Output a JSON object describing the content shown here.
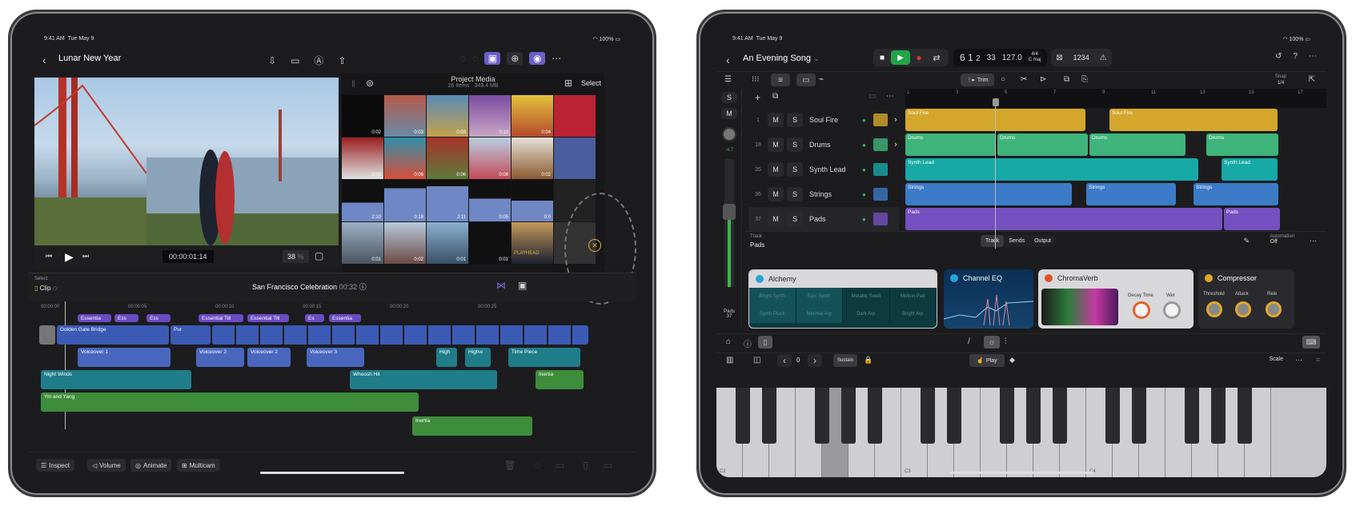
{
  "left_app": {
    "status_time": "9:41 AM",
    "status_date": "Tue May 9",
    "battery": "100%",
    "nav_title": "Lunar New Year",
    "media_browser": {
      "title": "Project Media",
      "subtitle": "26 Items · 349.4 MB",
      "select_label": "Select",
      "durations": [
        "0:02",
        "0:03",
        "0:03",
        "0:10",
        "0:04",
        "",
        "0:02",
        "0:06",
        "0:06",
        "0:08",
        "0:02",
        "",
        "2:10",
        "0:18",
        "2:11",
        "0:05",
        "0:0",
        "",
        "0:01",
        "0:02",
        "0:01",
        "0:01",
        "0:",
        ""
      ],
      "playhead_label": "PLAYHEAD"
    },
    "viewer": {
      "timecode": "00:00:01:14",
      "zoom_percent": "38",
      "zoom_unit": "%"
    },
    "timeline": {
      "select_label": "Select",
      "select_mode": "Clip",
      "project_title": "San Francisco Celebration",
      "project_duration": "00:32",
      "ruler_ticks": [
        "00:00:00",
        "00:00:05",
        "00:00:10",
        "00:00:15",
        "00:00:20",
        "00:00:25"
      ],
      "titles": [
        "Essentia",
        "Ess",
        "Ess",
        "Essential Titl",
        "Essential Titl",
        "Es",
        "Essentia"
      ],
      "primary_clips": [
        "Golden Gate Bridge",
        "Pur"
      ],
      "voiceovers": [
        "Voiceover 1",
        "Voiceover 2",
        "Voiceover 2",
        "Voiceover 3",
        "High",
        "Highw",
        "Time Piece"
      ],
      "sfx": [
        "Night Winds",
        "Whoosh Hit",
        "Inertia"
      ],
      "music": [
        "Yin and Yang",
        "Inertia"
      ]
    },
    "bottom_bar": {
      "inspect": "Inspect",
      "volume": "Volume",
      "animate": "Animate",
      "multicam": "Multicam"
    }
  },
  "right_app": {
    "status_time": "9:41 AM",
    "status_date": "Tue May 9",
    "battery": "100%",
    "song_title": "An Evening Song",
    "lcd": {
      "bar": "6",
      "beat": "1",
      "div": "2",
      "tick": "33",
      "tempo": "127.0",
      "signature": "4/4",
      "key": "C maj"
    },
    "count_in": "1234",
    "trim_label": "Trim",
    "snap_label": "Snap",
    "snap_value": "1/4",
    "ruler": [
      "1",
      "3",
      "5",
      "7",
      "9",
      "11",
      "13",
      "15",
      "17"
    ],
    "tracks": [
      {
        "num": "1",
        "name": "Soul Fire",
        "color": "#d4a72c",
        "regions": [
          "Soul Fire",
          "Soul Fire"
        ]
      },
      {
        "num": "18",
        "name": "Drums",
        "color": "#3fb47a",
        "regions": [
          "Drums",
          "Drums",
          "Drums",
          "Drums"
        ]
      },
      {
        "num": "35",
        "name": "Synth Lead",
        "color": "#17a9a6",
        "regions": [
          "Synth Lead",
          "Synth Lead"
        ]
      },
      {
        "num": "36",
        "name": "Strings",
        "color": "#3c7bc8",
        "regions": [
          "Strings",
          "Strings",
          "Strings"
        ]
      },
      {
        "num": "37",
        "name": "Pads",
        "color": "#7550c0",
        "regions": [
          "Pads",
          "Pads"
        ]
      }
    ],
    "mute_label": "M",
    "solo_label": "S",
    "channel_strip": {
      "s": "S",
      "m": "M",
      "gain": "-4.7",
      "name": "Pads",
      "num": "37",
      "level_fraction": 0.62
    },
    "inspector": {
      "track_label": "Track",
      "track_name": "Pads",
      "tabs": [
        "Track",
        "Sends",
        "Output"
      ],
      "automation_label": "Automation",
      "automation_value": "Off"
    },
    "plugins": [
      {
        "name": "Alchemy",
        "presets": [
          "Bright Synth",
          "Epic Synth",
          "Metallic Swell",
          "Motion Pad",
          "Synth Pluck",
          "Minimal Arp",
          "Dark Arp",
          "Bright Arp"
        ]
      },
      {
        "name": "Channel EQ"
      },
      {
        "name": "ChromaVerb",
        "knobs": [
          "Decay Time",
          "Wet"
        ]
      },
      {
        "name": "Compressor",
        "knobs": [
          "Threshold",
          "Attack",
          "Rele"
        ]
      }
    ],
    "keyboard": {
      "octave": "0",
      "sustain": "Sustain",
      "play": "Play",
      "scale": "Scale",
      "labels": [
        "C2",
        "C3",
        "C4"
      ]
    }
  }
}
